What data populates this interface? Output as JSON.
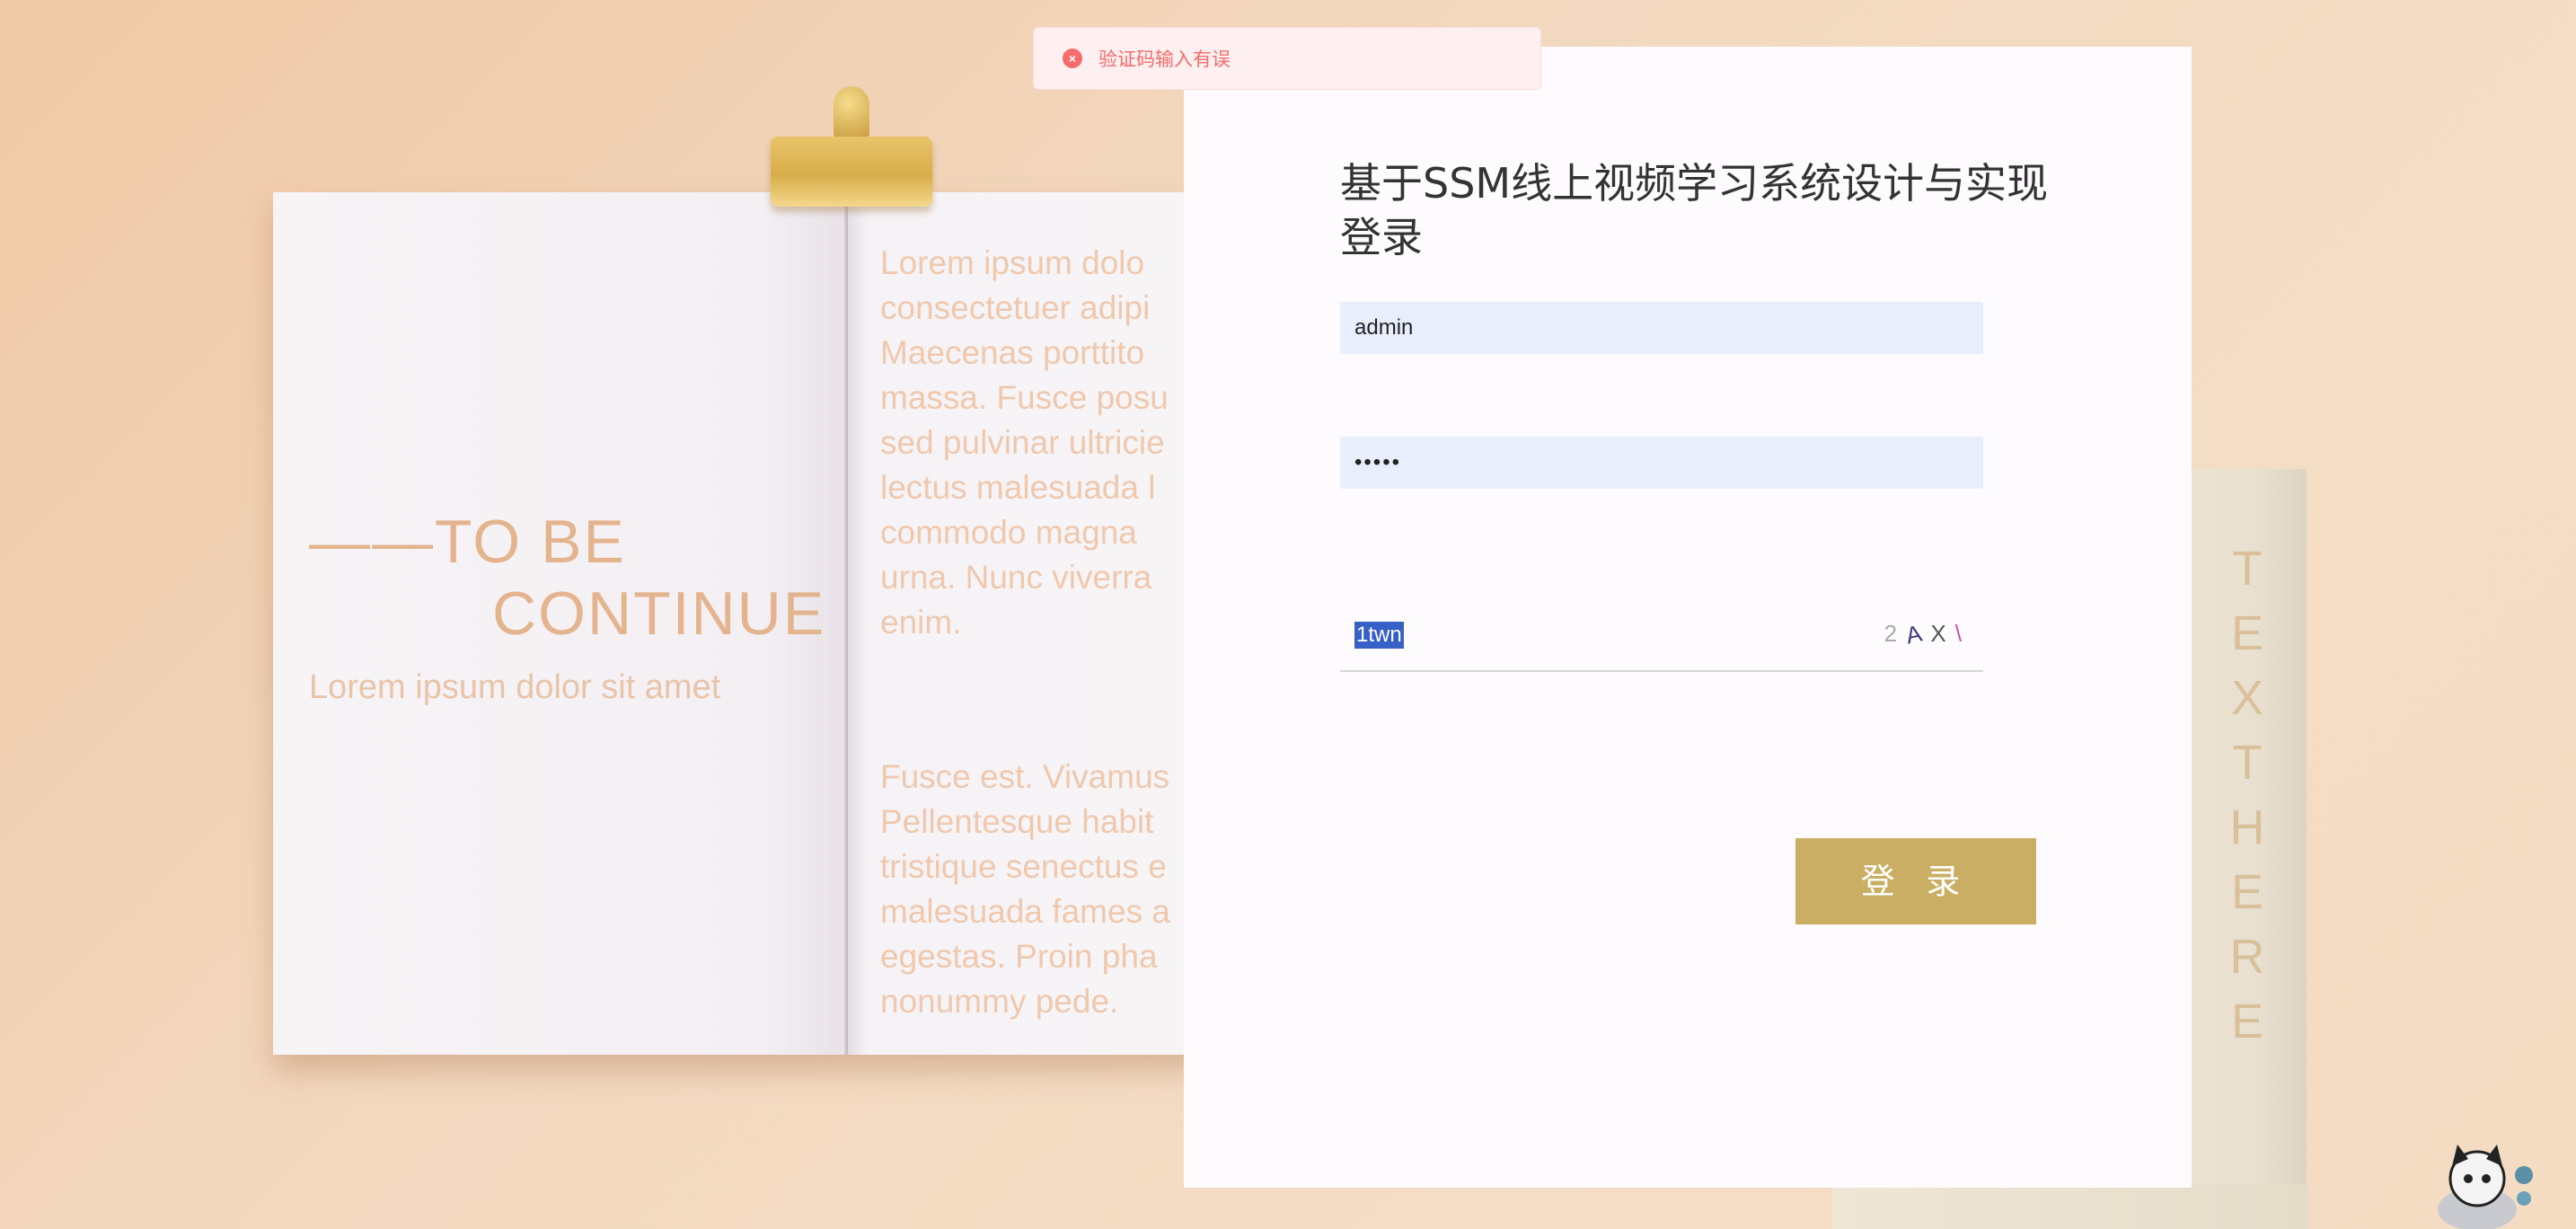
{
  "toast": {
    "message": "验证码输入有误",
    "type": "error"
  },
  "decor": {
    "tbc_line1": "——TO BE",
    "tbc_line2": "CONTINUE",
    "tbc_sub": "Lorem ipsum dolor sit amet",
    "lorem_1": "Lorem ipsum dolo consectetuer adipi Maecenas porttito massa. Fusce posu sed pulvinar ultricie lectus malesuada l commodo magna urna. Nunc viverra enim.",
    "lorem_2": "Fusce est. Vivamus Pellentesque habit tristique senectus e malesuada fames a egestas. Proin pha nonummy pede.",
    "bookmark_letters": [
      "T",
      "E",
      "X",
      "T",
      "H",
      "E",
      "R",
      "E"
    ]
  },
  "login": {
    "title": "基于SSM线上视频学习系统设计与实现登录",
    "username_value": "admin",
    "password_value": "•••••",
    "captcha_value": "1twn",
    "captcha_chars": [
      "2",
      "A",
      "X",
      "\\"
    ],
    "login_button": "登 录"
  },
  "colors": {
    "accent": "#c9ae63",
    "error": "#f56c6c",
    "field_bg": "#e8eefc"
  }
}
